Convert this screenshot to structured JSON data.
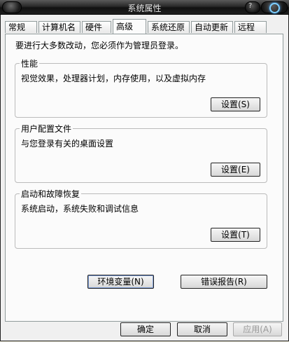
{
  "window": {
    "title": "系统属性"
  },
  "tabs": [
    {
      "label": "常规"
    },
    {
      "label": "计算机名"
    },
    {
      "label": "硬件"
    },
    {
      "label": "高级"
    },
    {
      "label": "系统还原"
    },
    {
      "label": "自动更新"
    },
    {
      "label": "远程"
    }
  ],
  "active_tab": "高级",
  "notice": "要进行大多数改动，您必须作为管理员登录。",
  "groups": {
    "performance": {
      "title": "性能",
      "description": "视觉效果，处理器计划，内存使用，以及虚拟内存",
      "button": "设置(S)"
    },
    "user_profiles": {
      "title": "用户配置文件",
      "description": "与您登录有关的桌面设置",
      "button": "设置(E)"
    },
    "startup_recovery": {
      "title": "启动和故障恢复",
      "description": "系统启动，系统失败和调试信息",
      "button": "设置(T)"
    }
  },
  "actions": {
    "env_vars": "环境变量(N)",
    "error_report": "错误报告(R)"
  },
  "footer": {
    "ok": "确定",
    "cancel": "取消",
    "apply": "应用(A)"
  }
}
